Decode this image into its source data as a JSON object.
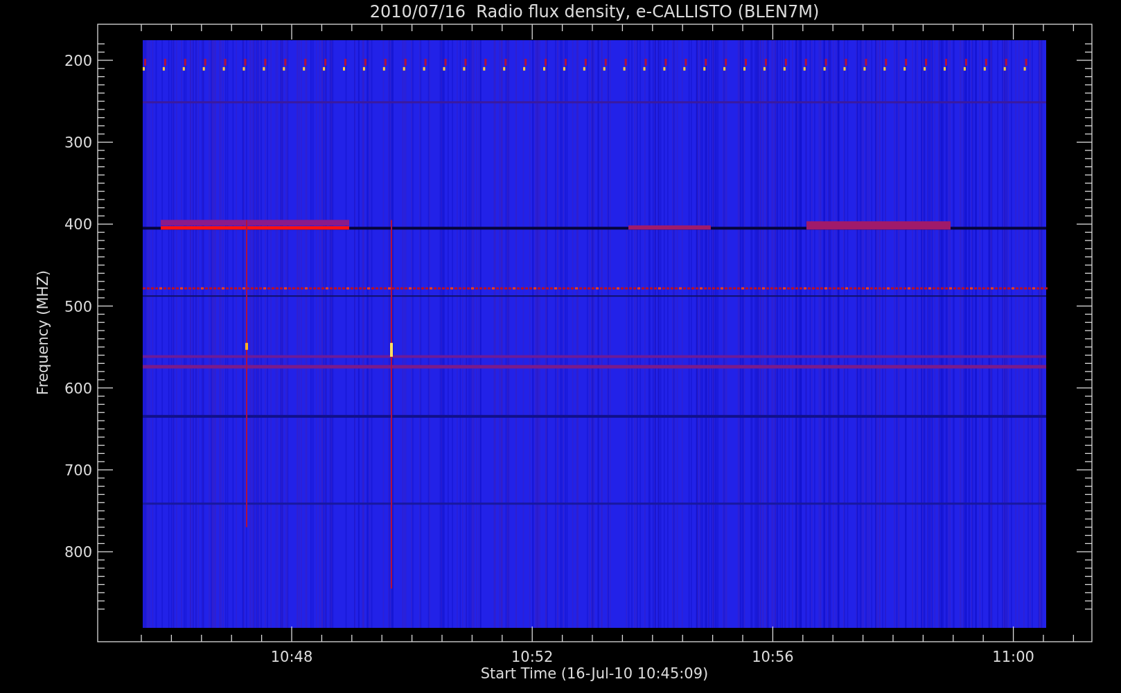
{
  "title": "2010/07/16  Radio flux density, e-CALLISTO (BLEN7M)",
  "y_axis": {
    "label": "Frequency (MHZ)",
    "ticks": [
      "200",
      "300",
      "400",
      "500",
      "600",
      "700",
      "800"
    ]
  },
  "x_axis": {
    "label": "Start Time (16-Jul-10 10:45:09)",
    "ticks": [
      "10:48",
      "10:52",
      "10:56",
      "11:00"
    ]
  }
}
